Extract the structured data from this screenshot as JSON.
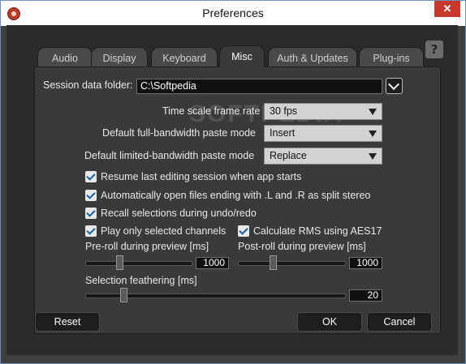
{
  "window": {
    "title": "Preferences",
    "close_glyph": "✕"
  },
  "tabs": [
    {
      "label": "Audio"
    },
    {
      "label": "Display"
    },
    {
      "label": "Keyboard"
    },
    {
      "label": "Misc"
    },
    {
      "label": "Auth & Updates"
    },
    {
      "label": "Plug-ins"
    }
  ],
  "active_tab": "Misc",
  "help_glyph": "?",
  "session": {
    "label": "Session data folder:",
    "value": "C:\\Softpedia"
  },
  "settings": {
    "time_scale": {
      "label": "Time scale frame rate",
      "value": "30 fps"
    },
    "full_paste": {
      "label": "Default full-bandwidth paste mode",
      "value": "Insert"
    },
    "limited_paste": {
      "label": "Default limited-bandwidth paste mode",
      "value": "Replace"
    }
  },
  "checkboxes": [
    {
      "label": "Resume last editing session when app starts",
      "checked": true
    },
    {
      "label": "Automatically open files ending with .L and .R as split stereo",
      "checked": true
    },
    {
      "label": "Recall selections during undo/redo",
      "checked": true
    },
    {
      "label": "Play only selected channels",
      "checked": true
    },
    {
      "label": "Calculate RMS using AES17",
      "checked": true
    }
  ],
  "sliders": {
    "preroll": {
      "label": "Pre-roll during preview [ms]",
      "value": "1000",
      "level": 0.33
    },
    "postroll": {
      "label": "Post-roll during preview [ms]",
      "value": "1000",
      "level": 0.33
    },
    "feathering": {
      "label": "Selection feathering [ms]",
      "value": "20",
      "level": 0.15
    }
  },
  "buttons": {
    "reset": "Reset",
    "ok": "OK",
    "cancel": "Cancel"
  },
  "watermark": "SOFTPEDIA"
}
